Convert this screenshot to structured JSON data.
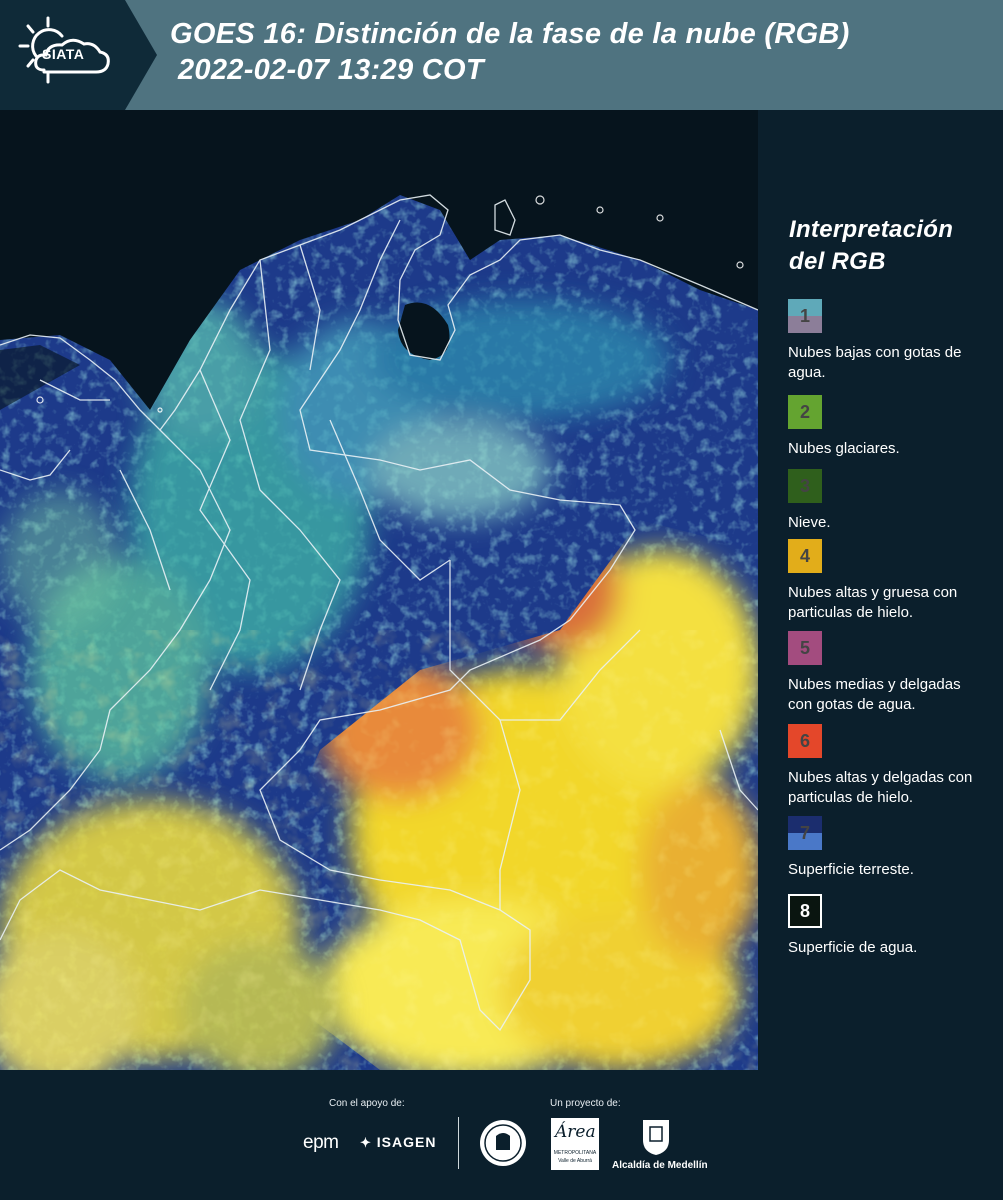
{
  "header": {
    "logo_text": "SIATA",
    "title_line1": "GOES 16: Distinción de la fase de la nube (RGB)",
    "title_line2": "2022-02-07 13:29 COT"
  },
  "legend": {
    "title_line1": "Interpretación",
    "title_line2": "del RGB",
    "items": [
      {
        "number": "1",
        "label": "Nubes bajas con gotas de agua.",
        "color_top": "#5fa9b9",
        "color_bottom": "#8c7e99"
      },
      {
        "number": "2",
        "label": "Nubes glaciares.",
        "color_top": "#64a430",
        "color_bottom": "#64a430"
      },
      {
        "number": "3",
        "label": "Nieve.",
        "color_top": "#2f5f1c",
        "color_bottom": "#2f5f1c"
      },
      {
        "number": "4",
        "label": "Nubes altas y gruesa con particulas de hielo.",
        "color_top": "#e2ad1a",
        "color_bottom": "#e2ad1a"
      },
      {
        "number": "5",
        "label": "Nubes medias y delgadas con gotas de agua.",
        "color_top": "#a34c7f",
        "color_bottom": "#a34c7f"
      },
      {
        "number": "6",
        "label": "Nubes altas y delgadas con particulas de hielo.",
        "color_top": "#e4472a",
        "color_bottom": "#e4472a"
      },
      {
        "number": "7",
        "label": "Superficie terreste.",
        "color_top": "#1b2d6e",
        "color_bottom": "#4a78c8"
      },
      {
        "number": "8",
        "label": "Superficie de agua.",
        "color_top": "#0a1510",
        "color_bottom": "#0a1510"
      }
    ]
  },
  "footer": {
    "support_label": "Con el apoyo de:",
    "project_label": "Un proyecto de:",
    "sponsor1": "epm",
    "sponsor2": "ISAGEN",
    "partner1_line1": "METROPOLITANA",
    "partner1_line2": "Valle de Aburrá",
    "partner2": "Alcaldía de Medellín"
  }
}
